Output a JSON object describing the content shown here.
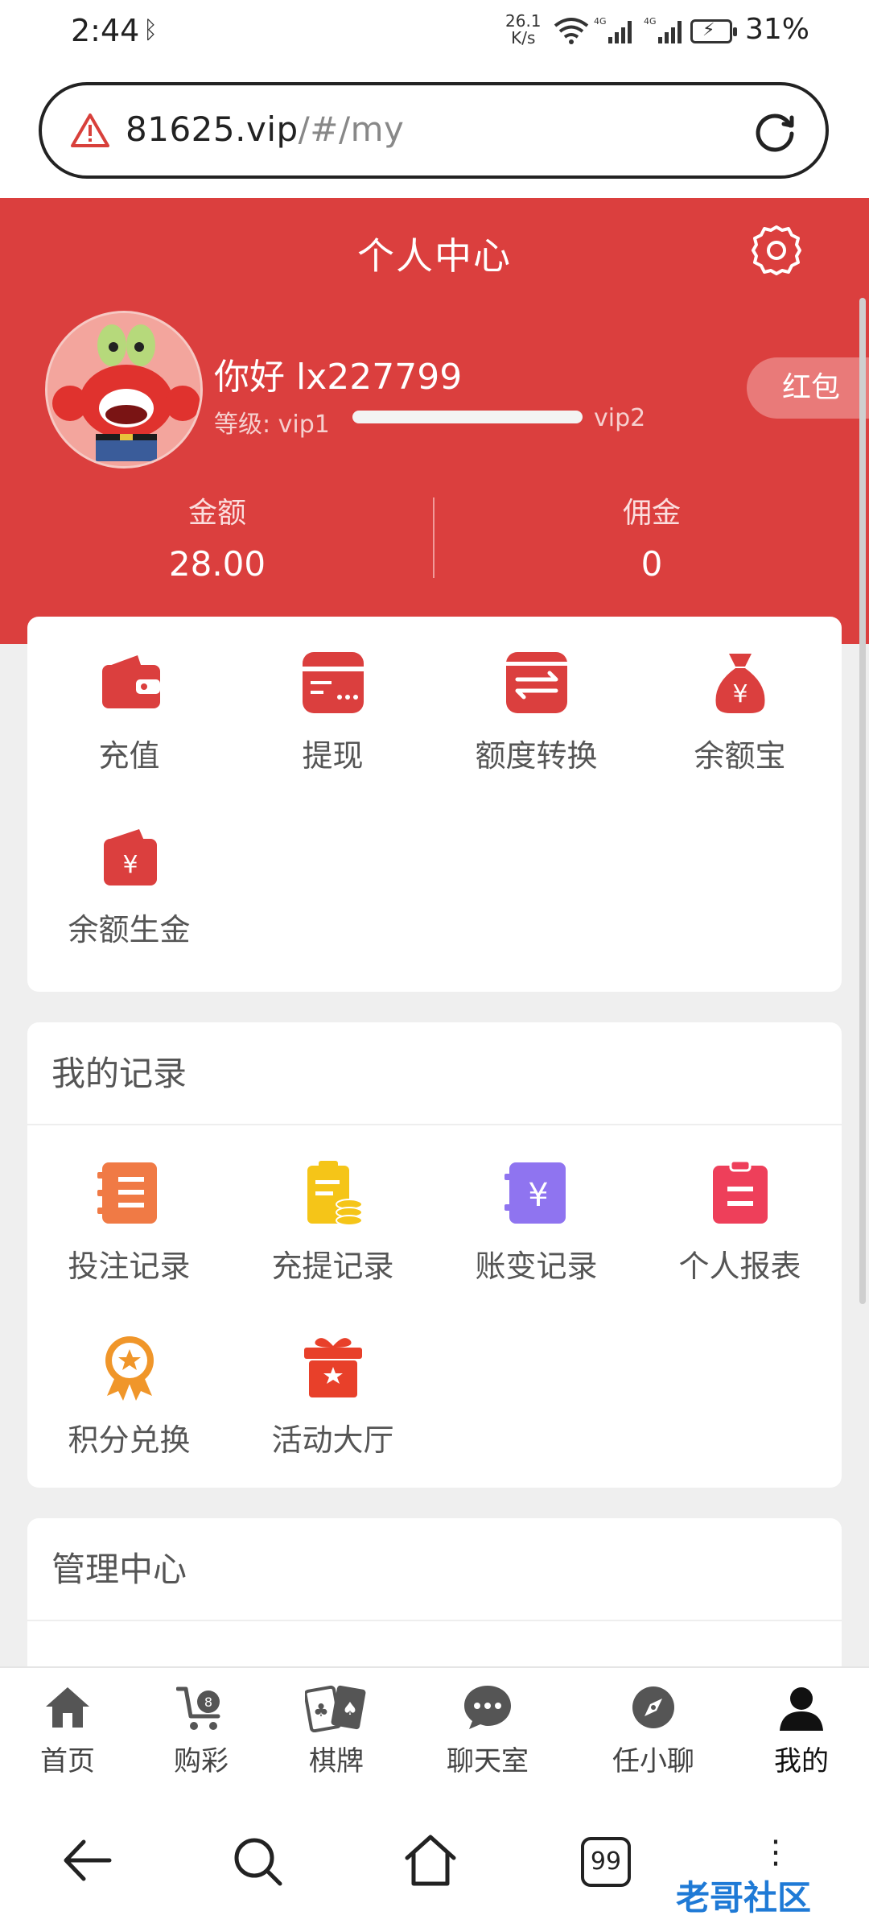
{
  "status": {
    "time": "2:44",
    "net_speed_value": "26.1",
    "net_speed_unit": "K/s",
    "signal_label_1": "4G",
    "signal_label_2": "4G",
    "battery": "31%"
  },
  "browser": {
    "url_host": "81625.vip",
    "url_path": "/#/my"
  },
  "header": {
    "title": "个人中心",
    "greeting": "你好 lx227799",
    "level_label": "等级: vip1",
    "level_next": "vip2",
    "level_progress": 1.0,
    "red_packet": "红包",
    "balance_label": "金额",
    "balance_value": "28.00",
    "commission_label": "佣金",
    "commission_value": "0"
  },
  "wallet": {
    "items": [
      {
        "label": "充值",
        "icon": "wallet-icon"
      },
      {
        "label": "提现",
        "icon": "card-icon"
      },
      {
        "label": "额度转换",
        "icon": "transfer-icon"
      },
      {
        "label": "余额宝",
        "icon": "money-bag-icon"
      },
      {
        "label": "余额生金",
        "icon": "yen-wallet-icon"
      }
    ]
  },
  "records": {
    "title": "我的记录",
    "items": [
      {
        "label": "投注记录",
        "icon": "bet-record-icon"
      },
      {
        "label": "充提记录",
        "icon": "deposit-record-icon"
      },
      {
        "label": "账变记录",
        "icon": "account-change-icon"
      },
      {
        "label": "个人报表",
        "icon": "report-icon"
      },
      {
        "label": "积分兑换",
        "icon": "points-medal-icon"
      },
      {
        "label": "活动大厅",
        "icon": "gift-icon"
      }
    ]
  },
  "management": {
    "title": "管理中心"
  },
  "tabbar": {
    "items": [
      {
        "label": "首页",
        "icon": "home-icon"
      },
      {
        "label": "购彩",
        "icon": "cart-icon"
      },
      {
        "label": "棋牌",
        "icon": "cards-icon"
      },
      {
        "label": "聊天室",
        "icon": "chat-icon"
      },
      {
        "label": "任小聊",
        "icon": "compass-icon"
      },
      {
        "label": "我的",
        "icon": "user-icon"
      }
    ],
    "active": "我的"
  },
  "nav": {
    "tab_count": "99",
    "more": "⋮"
  },
  "watermark": "老哥社区",
  "colors": {
    "primary_red": "#db3f3e",
    "record_orange": "#f07a45",
    "record_yellow": "#f5c518",
    "record_purple": "#8f74f0",
    "record_pink": "#ee3f5a"
  }
}
